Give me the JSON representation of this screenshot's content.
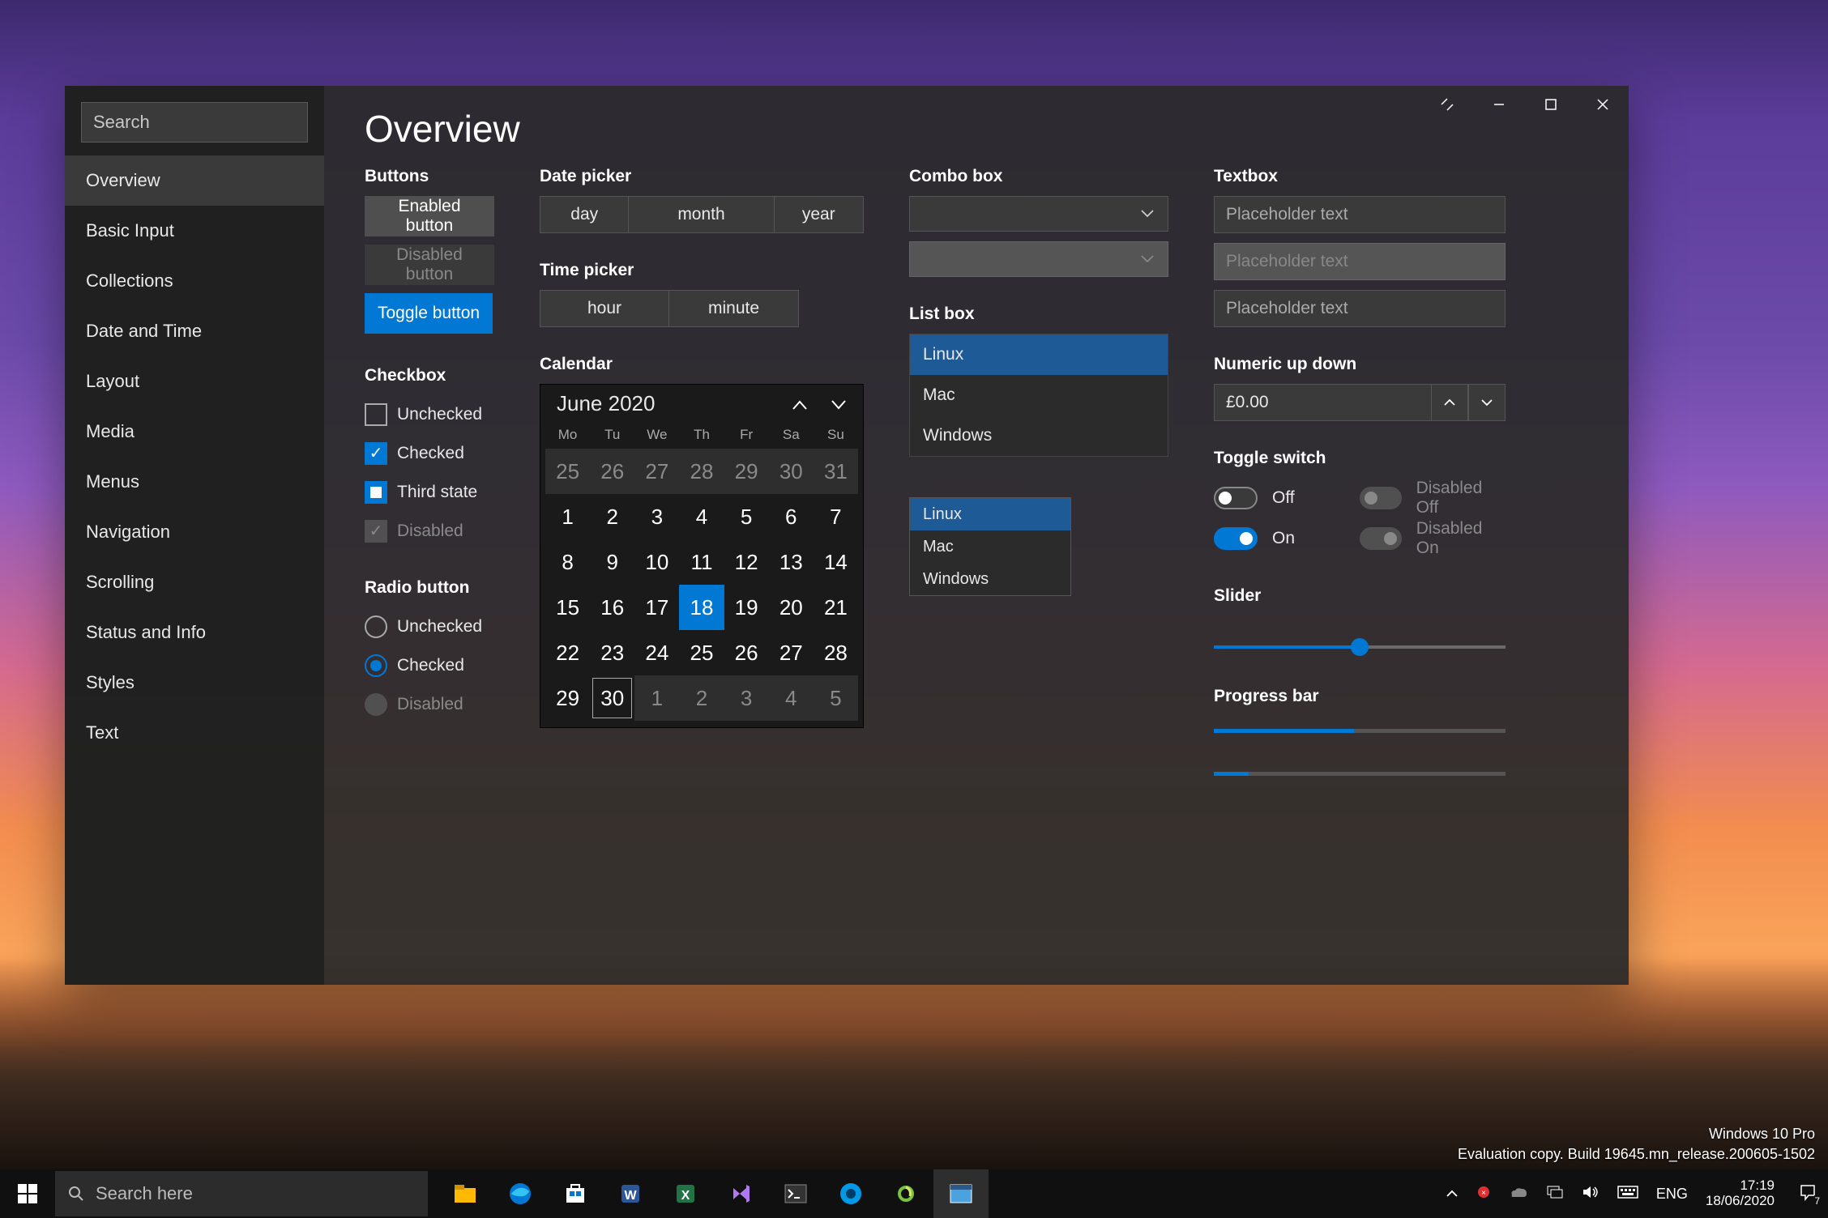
{
  "sidebar": {
    "search_placeholder": "Search",
    "items": [
      "Overview",
      "Basic Input",
      "Collections",
      "Date and Time",
      "Layout",
      "Media",
      "Menus",
      "Navigation",
      "Scrolling",
      "Status and Info",
      "Styles",
      "Text"
    ],
    "selected": 0
  },
  "page_title": "Overview",
  "buttons": {
    "title": "Buttons",
    "enabled": "Enabled button",
    "disabled": "Disabled button",
    "toggle": "Toggle button"
  },
  "checkbox": {
    "title": "Checkbox",
    "unchecked": "Unchecked",
    "checked": "Checked",
    "third": "Third state",
    "disabled": "Disabled"
  },
  "radio": {
    "title": "Radio button",
    "unchecked": "Unchecked",
    "checked": "Checked",
    "disabled": "Disabled"
  },
  "date_picker": {
    "title": "Date picker",
    "day": "day",
    "month": "month",
    "year": "year"
  },
  "time_picker": {
    "title": "Time picker",
    "hour": "hour",
    "minute": "minute"
  },
  "calendar": {
    "title": "Calendar",
    "month_label": "June 2020",
    "dow": [
      "Mo",
      "Tu",
      "We",
      "Th",
      "Fr",
      "Sa",
      "Su"
    ],
    "days": [
      {
        "n": "25",
        "dim": true
      },
      {
        "n": "26",
        "dim": true
      },
      {
        "n": "27",
        "dim": true
      },
      {
        "n": "28",
        "dim": true
      },
      {
        "n": "29",
        "dim": true
      },
      {
        "n": "30",
        "dim": true
      },
      {
        "n": "31",
        "dim": true
      },
      {
        "n": "1"
      },
      {
        "n": "2"
      },
      {
        "n": "3"
      },
      {
        "n": "4"
      },
      {
        "n": "5"
      },
      {
        "n": "6"
      },
      {
        "n": "7"
      },
      {
        "n": "8"
      },
      {
        "n": "9"
      },
      {
        "n": "10"
      },
      {
        "n": "11"
      },
      {
        "n": "12"
      },
      {
        "n": "13"
      },
      {
        "n": "14"
      },
      {
        "n": "15"
      },
      {
        "n": "16"
      },
      {
        "n": "17"
      },
      {
        "n": "18",
        "sel": true
      },
      {
        "n": "19"
      },
      {
        "n": "20"
      },
      {
        "n": "21"
      },
      {
        "n": "22"
      },
      {
        "n": "23"
      },
      {
        "n": "24"
      },
      {
        "n": "25"
      },
      {
        "n": "26"
      },
      {
        "n": "27"
      },
      {
        "n": "28"
      },
      {
        "n": "29"
      },
      {
        "n": "30",
        "today": true
      },
      {
        "n": "1",
        "dim": true
      },
      {
        "n": "2",
        "dim": true
      },
      {
        "n": "3",
        "dim": true
      },
      {
        "n": "4",
        "dim": true
      },
      {
        "n": "5",
        "dim": true
      }
    ]
  },
  "combo": {
    "title": "Combo box"
  },
  "listbox": {
    "title": "List box",
    "items": [
      "Linux",
      "Mac",
      "Windows"
    ]
  },
  "textbox": {
    "title": "Textbox",
    "placeholder": "Placeholder text"
  },
  "numeric": {
    "title": "Numeric up down",
    "value": "£0.00"
  },
  "toggle": {
    "title": "Toggle switch",
    "off": "Off",
    "on": "On",
    "doff": "Disabled Off",
    "don": "Disabled On"
  },
  "slider": {
    "title": "Slider",
    "value_pct": 50
  },
  "progress": {
    "title": "Progress bar",
    "p1": 48,
    "p2": 12
  },
  "taskbar": {
    "search_placeholder": "Search here",
    "lang": "ENG",
    "time": "17:19",
    "date": "18/06/2020",
    "notif_count": "7"
  },
  "eval": {
    "l1": "Windows 10 Pro",
    "l2": "Evaluation copy. Build 19645.mn_release.200605-1502"
  }
}
